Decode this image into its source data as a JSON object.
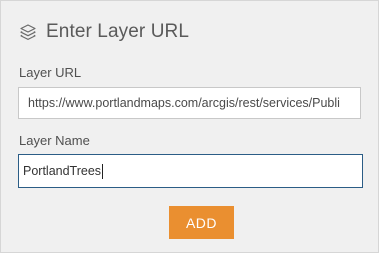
{
  "header": {
    "icon": "layers-icon",
    "title": "Enter Layer URL"
  },
  "form": {
    "layer_url": {
      "label": "Layer URL",
      "value": "https://www.portlandmaps.com/arcgis/rest/services/Publi"
    },
    "layer_name": {
      "label": "Layer Name",
      "value": "PortlandTrees"
    },
    "add_label": "ADD"
  },
  "colors": {
    "panel_background": "#f0f0f0",
    "accent_button": "#ea8f30",
    "focused_border": "#2b5d86",
    "title_text": "#5a5a5a"
  }
}
